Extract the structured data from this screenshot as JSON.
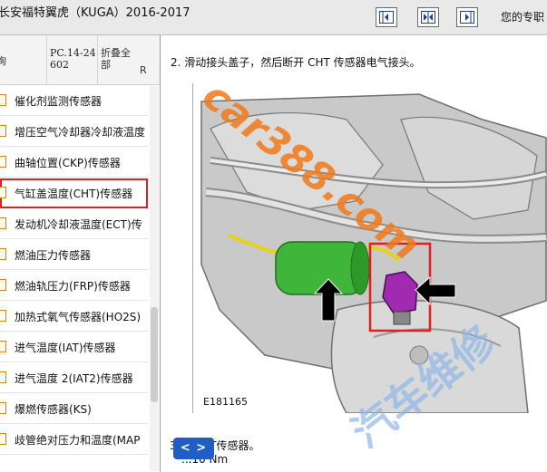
{
  "window": {
    "title": "长安福特翼虎（KUGA）2016-2017",
    "right_label": "您的专职"
  },
  "toolbar": {
    "buttons": [
      {
        "icon": "collapse-left-icon"
      },
      {
        "icon": "split-icon"
      },
      {
        "icon": "collapse-right-icon"
      }
    ]
  },
  "left_panel": {
    "header": {
      "col1": "询",
      "col2": "PC.14-24602",
      "col3": "折叠全部",
      "col4": "R"
    },
    "items": [
      {
        "label": "催化剂监测传感器",
        "selected": false
      },
      {
        "label": "增压空气冷却器冷却液温度",
        "selected": false
      },
      {
        "label": "曲轴位置(CKP)传感器",
        "selected": false
      },
      {
        "label": "气缸盖温度(CHT)传感器",
        "selected": true
      },
      {
        "label": "发动机冷却液温度(ECT)传",
        "selected": false
      },
      {
        "label": "燃油压力传感器",
        "selected": false
      },
      {
        "label": "燃油轨压力(FRP)传感器",
        "selected": false
      },
      {
        "label": "加热式氧气传感器(HO2S)",
        "selected": false
      },
      {
        "label": "进气温度(IAT)传感器",
        "selected": false
      },
      {
        "label": "进气温度 2(IAT2)传感器",
        "selected": false
      },
      {
        "label": "爆燃传感器(KS)",
        "selected": false
      },
      {
        "label": "歧管绝对压力和温度(MAP",
        "selected": false
      }
    ]
  },
  "content": {
    "step2": "2. 滑动接头盖子，然后断开 CHT 传感器电气接头。",
    "figure_label": "E181165",
    "step3": "3. ...CHT传感器。",
    "torque": "...10 Nm"
  },
  "nav_button": {
    "label": "< >"
  },
  "watermark": {
    "text1": "car388.com",
    "text2": "汽车维修",
    "color": "#f07a1c"
  },
  "colors": {
    "highlight_red": "#e02020",
    "nav_blue": "#1f5fc5",
    "connector_purple": "#a02ab0",
    "sensor_green": "#3fb63a"
  }
}
